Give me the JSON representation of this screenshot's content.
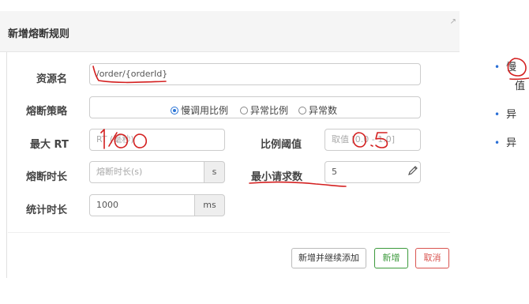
{
  "dialog": {
    "title": "新增熔断规则",
    "fields": {
      "resource_label": "资源名",
      "resource_value": "/order/{orderId}",
      "strategy_label": "熔断策略",
      "strategy_options": [
        "慢调用比例",
        "异常比例",
        "异常数"
      ],
      "strategy_selected": "慢调用比例",
      "max_rt_label": "最大 RT",
      "max_rt_placeholder": "RT (毫秒)",
      "ratio_label": "比例阈值",
      "ratio_placeholder": "取值 [0.0 - 1.0]",
      "duration_label": "熔断时长",
      "duration_placeholder": "熔断时长(s)",
      "duration_unit": "s",
      "min_request_label": "最小请求数",
      "min_request_value": "5",
      "stat_label": "统计时长",
      "stat_value": "1000",
      "stat_unit": "ms"
    },
    "buttons": {
      "continue": "新增并继续添加",
      "add": "新增",
      "cancel": "取消"
    }
  },
  "side_list": {
    "items": [
      "慢",
      "值",
      "异",
      "异"
    ]
  },
  "colors": {
    "accent": "#2a74d6",
    "success": "#3c9a3c",
    "danger": "#d9534f",
    "annotation": "#d42020"
  }
}
